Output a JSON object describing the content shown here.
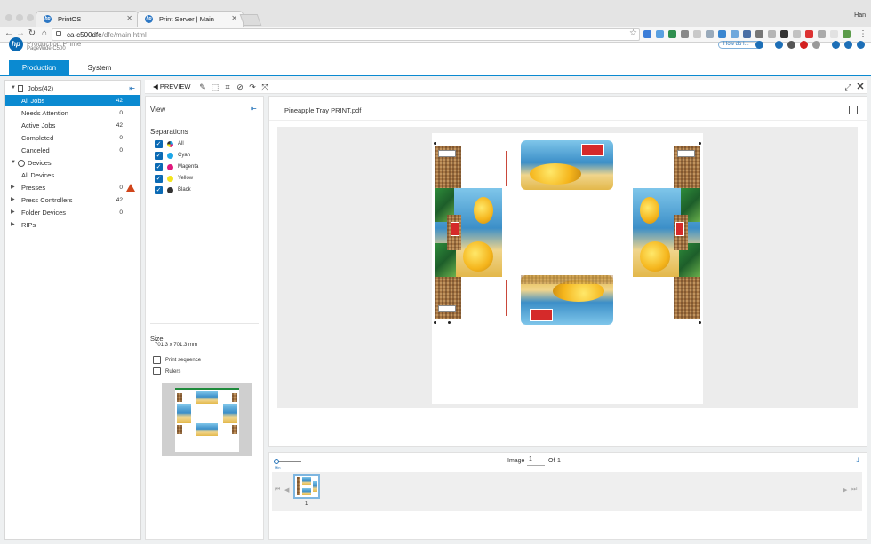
{
  "browser": {
    "tabs": [
      {
        "label": "PrintOS",
        "icon": "hp-logo-icon"
      },
      {
        "label": "Print Server | Main",
        "icon": "hp-logo-icon"
      }
    ],
    "user": "Han",
    "url_host": "ca-c500dfe",
    "url_path": "/dfe/main.html"
  },
  "app": {
    "product_line": "Production Prime",
    "model": "PageWide C500",
    "help_label": "How do I..."
  },
  "nav": {
    "tabs": [
      "Production",
      "System"
    ],
    "active": "Production"
  },
  "sidebar": {
    "jobs_header": "Jobs(42)",
    "jobs": [
      {
        "label": "All Jobs",
        "count": "42",
        "selected": true
      },
      {
        "label": "Needs Attention",
        "count": "0"
      },
      {
        "label": "Active Jobs",
        "count": "42"
      },
      {
        "label": "Completed",
        "count": "0"
      },
      {
        "label": "Canceled",
        "count": "0"
      }
    ],
    "devices_header": "Devices",
    "devices": [
      {
        "label": "All Devices",
        "count": ""
      },
      {
        "label": "Presses",
        "count": "0",
        "warning": true
      },
      {
        "label": "Press Controllers",
        "count": "42"
      },
      {
        "label": "Folder Devices",
        "count": "0"
      },
      {
        "label": "RIPs",
        "count": ""
      }
    ]
  },
  "toolbar": {
    "preview_label": "PREVIEW"
  },
  "view": {
    "title": "View",
    "separations_title": "Separations",
    "separations": [
      {
        "label": "All",
        "color": "multi",
        "checked": true
      },
      {
        "label": "Cyan",
        "color": "#1ea7e8",
        "checked": true
      },
      {
        "label": "Magenta",
        "color": "#e0197d",
        "checked": true
      },
      {
        "label": "Yellow",
        "color": "#f3e51c",
        "checked": true
      },
      {
        "label": "Black",
        "color": "#333333",
        "checked": true
      }
    ],
    "size_title": "Size",
    "size_value": "701.3 x 701.3 mm",
    "print_sequence_label": "Print sequence",
    "print_sequence_checked": false,
    "rulers_label": "Rulers",
    "rulers_checked": false
  },
  "preview": {
    "filename": "Pineapple Tray PRINT.pdf",
    "image_label": "Image",
    "image_current": "1",
    "image_of_label": "Of",
    "image_total": "1",
    "thumb_label": "1",
    "zoom_label": "Min"
  }
}
